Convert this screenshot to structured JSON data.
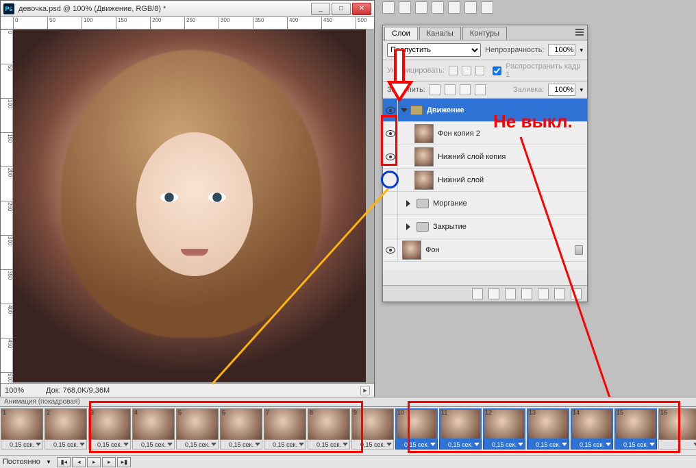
{
  "window": {
    "title": "девочка.psd @ 100% (Движение, RGB/8) *",
    "min": "_",
    "max": "□",
    "close": "✕"
  },
  "ruler_h": [
    "0",
    "50",
    "100",
    "150",
    "200",
    "250",
    "300",
    "350",
    "400",
    "450",
    "500"
  ],
  "ruler_v": [
    "0",
    "50",
    "100",
    "150",
    "200",
    "250",
    "300",
    "350",
    "400",
    "450",
    "500"
  ],
  "status": {
    "zoom": "100%",
    "doc": "Док: 768,0K/9,36M"
  },
  "panel": {
    "tabs": {
      "layers": "Слои",
      "channels": "Каналы",
      "paths": "Контуры"
    },
    "blend_mode": "Пропустить",
    "opacity_label": "Непрозрачность:",
    "opacity_val": "100%",
    "unify_label": "Унифицировать:",
    "propagate_label": "Распространить кадр 1",
    "lock_label": "Закрепить:",
    "fill_label": "Заливка:",
    "fill_val": "100%"
  },
  "layers": [
    {
      "name": "Движение",
      "type": "group-open",
      "eye": true,
      "active": true
    },
    {
      "name": "Фон копия 2",
      "type": "layer",
      "eye": true,
      "indent": 2
    },
    {
      "name": "Нижний слой копия",
      "type": "layer",
      "eye": true,
      "indent": 2
    },
    {
      "name": "Нижний слой",
      "type": "layer",
      "eye": false,
      "indent": 2
    },
    {
      "name": "Моргание",
      "type": "group-closed",
      "eye": false,
      "indent": 1
    },
    {
      "name": "Закрытие",
      "type": "group-closed",
      "eye": false,
      "indent": 1
    },
    {
      "name": "Фон",
      "type": "layer",
      "eye": true,
      "indent": 0,
      "locked": true
    }
  ],
  "annotations": {
    "text": "Не выкл."
  },
  "timeline": {
    "header": "Анимация (покадровая)",
    "mode": "Постоянно",
    "frames": [
      {
        "n": 1,
        "delay": "0,15 сек.",
        "sel": false
      },
      {
        "n": 2,
        "delay": "0,15 сек.",
        "sel": false
      },
      {
        "n": 3,
        "delay": "0,15 сек.",
        "sel": false
      },
      {
        "n": 4,
        "delay": "0,15 сек.",
        "sel": false
      },
      {
        "n": 5,
        "delay": "0,15 сек.",
        "sel": false
      },
      {
        "n": 6,
        "delay": "0,15 сек.",
        "sel": false
      },
      {
        "n": 7,
        "delay": "0,15 сек.",
        "sel": false
      },
      {
        "n": 8,
        "delay": "0,15 сек.",
        "sel": false
      },
      {
        "n": 9,
        "delay": "0,15 сек.",
        "sel": false
      },
      {
        "n": 10,
        "delay": "0,15 сек.",
        "sel": true
      },
      {
        "n": 11,
        "delay": "0,15 сек.",
        "sel": true
      },
      {
        "n": 12,
        "delay": "0,15 сек.",
        "sel": true
      },
      {
        "n": 13,
        "delay": "0,15 сек.",
        "sel": true
      },
      {
        "n": 14,
        "delay": "0,15 сек.",
        "sel": true
      },
      {
        "n": 15,
        "delay": "0,15 сек.",
        "sel": true
      },
      {
        "n": 16,
        "delay": "",
        "sel": false
      }
    ]
  }
}
